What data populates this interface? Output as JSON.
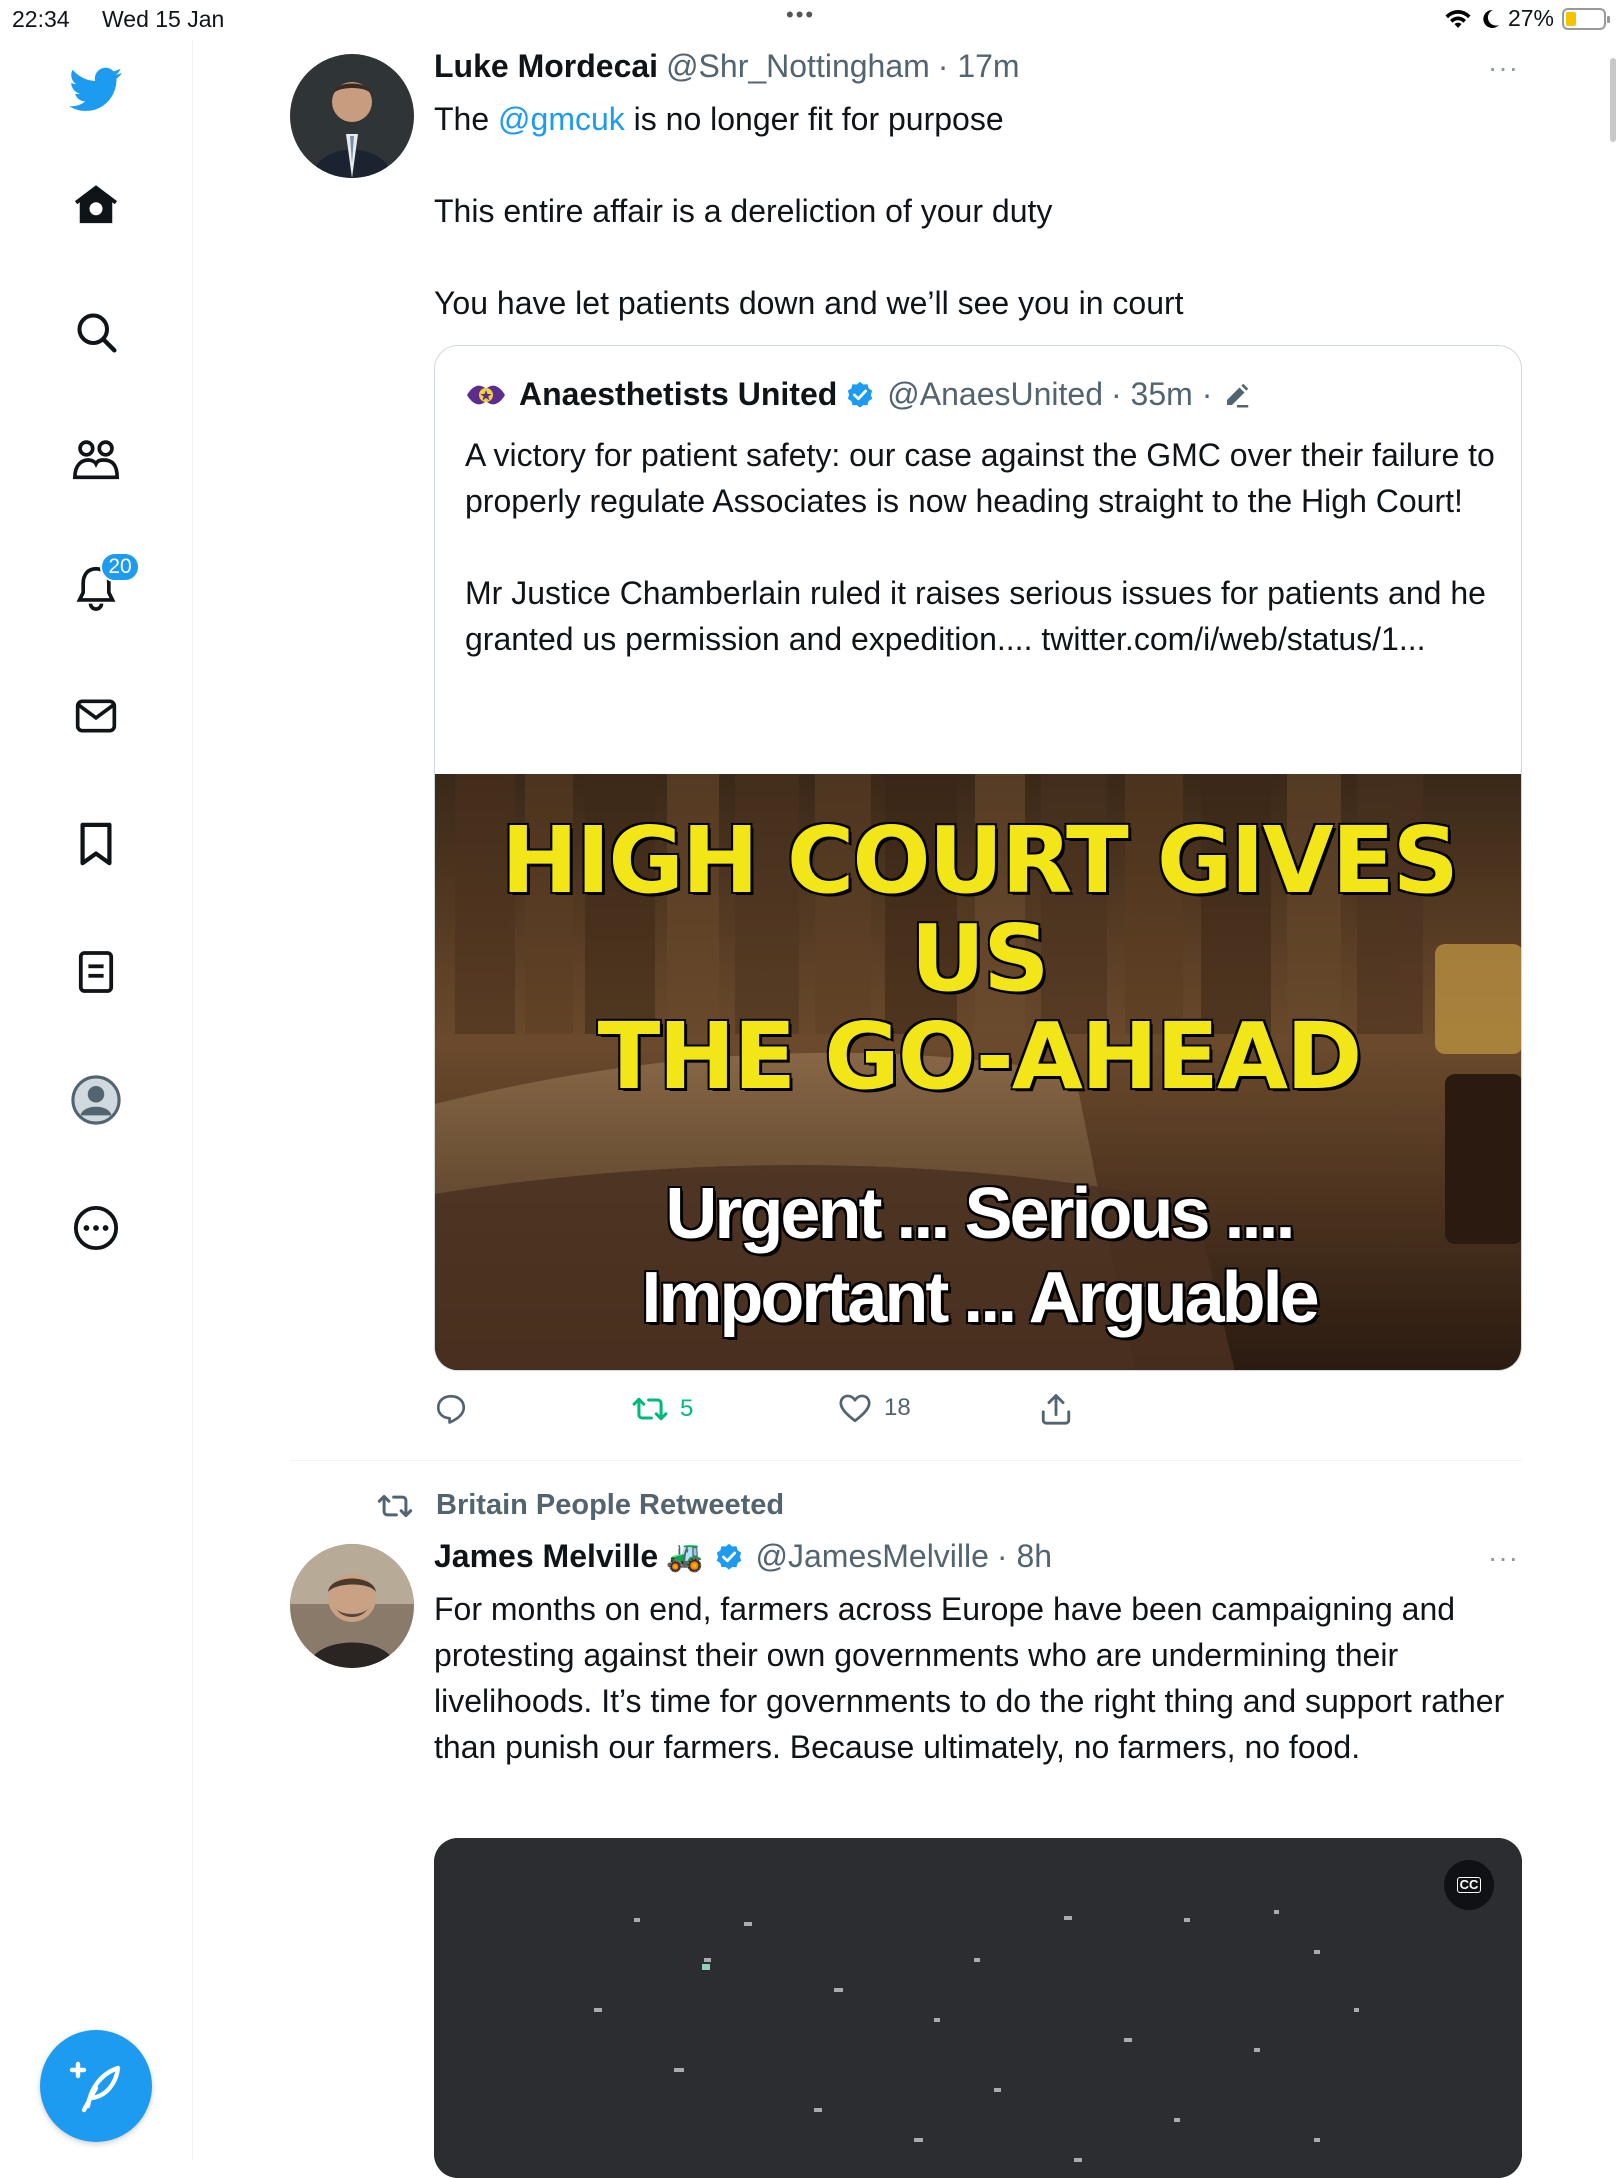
{
  "status_bar": {
    "time": "22:34",
    "date": "Wed 15 Jan",
    "battery_percent": "27%",
    "battery_level": 0.27,
    "dots": "•••"
  },
  "sidebar": {
    "items": [
      {
        "name": "twitter-logo"
      },
      {
        "name": "home"
      },
      {
        "name": "search"
      },
      {
        "name": "communities"
      },
      {
        "name": "notifications",
        "badge": "20"
      },
      {
        "name": "messages"
      },
      {
        "name": "bookmarks"
      },
      {
        "name": "lists"
      },
      {
        "name": "profile"
      },
      {
        "name": "more"
      }
    ],
    "compose_icon": "compose-icon"
  },
  "tweet1": {
    "name": "Luke Mordecai",
    "handle": "@Shr_Nottingham",
    "time": "· 17m",
    "more": "···",
    "text_prefix": "The ",
    "mention": "@gmcuk",
    "text_suffix": " is no longer fit for purpose",
    "line2": "This entire affair is a dereliction of your duty",
    "line3": "You have let patients down and we’ll see you in court",
    "quote": {
      "name": "Anaesthetists United",
      "handle": "@AnaesUnited",
      "time": "· 35m ·",
      "para1": "A victory for patient safety: our case against the GMC over their failure to properly regulate Associates is now heading straight to the High Court!",
      "para2": "Mr Justice Chamberlain ruled it raises serious issues for patients and he granted us permission and expedition.... twitter.com/i/web/status/1...",
      "image": {
        "headline1": "HIGH COURT GIVES US",
        "headline2": "THE GO-AHEAD",
        "sub1": "Urgent ... Serious ....",
        "sub2": "Important ... Arguable"
      }
    },
    "actions": {
      "reply": "",
      "retweets": "5",
      "likes": "18",
      "share": ""
    }
  },
  "tweet2": {
    "retweeted_by": "Britain People Retweeted",
    "name": "James Melville",
    "emoji": "🚜",
    "handle": "@JamesMelville",
    "time": "· 8h",
    "more": "···",
    "text": "For months on end, farmers across Europe have been campaigning and protesting against their own governments who are undermining their livelihoods. It’s time for governments to do the right thing and support rather than punish our farmers. Because ultimately, no farmers, no food.",
    "video_cc": "CC"
  },
  "colors": {
    "accent": "#1d9bf0",
    "retweet_green": "#00ba7c",
    "secondary_text": "#536471",
    "headline_yellow": "#f2e619"
  }
}
